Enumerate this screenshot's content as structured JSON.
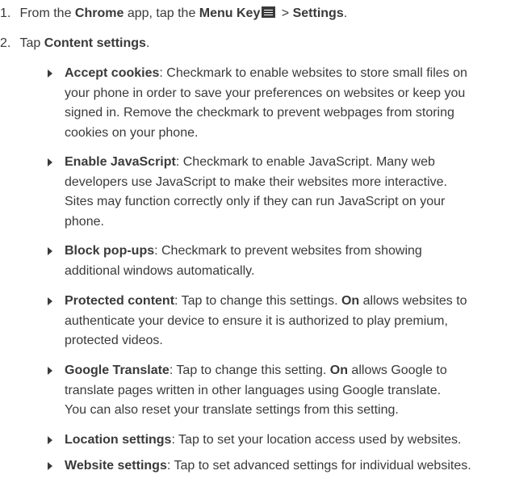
{
  "steps": [
    {
      "number": "1.",
      "pre": "From the ",
      "app": "Chrome",
      "mid1": " app, tap the ",
      "menu_key": "Menu Key",
      "icon": "menu-key-icon",
      "mid2": " > ",
      "settings": "Settings",
      "end": "."
    },
    {
      "number": "2.",
      "pre": "Tap ",
      "target": "Content settings",
      "end": "."
    }
  ],
  "bullets": [
    {
      "term": "Accept cookies",
      "desc_lines": [
        ": Checkmark to enable websites to store small files on",
        "your phone in order to save your preferences on websites or keep you",
        "signed in. Remove the checkmark to prevent webpages from storing",
        "cookies on your phone."
      ]
    },
    {
      "term": "Enable JavaScript",
      "desc_lines": [
        ": Checkmark to enable JavaScript. Many web",
        "developers use JavaScript to make their websites more interactive.",
        "Sites may function correctly only if they can run JavaScript on your",
        "phone."
      ]
    },
    {
      "term": "Block pop-ups",
      "desc_lines": [
        ": Checkmark to prevent websites from showing",
        "additional windows automatically."
      ]
    },
    {
      "term": "Protected content",
      "desc_pre": ": Tap to change this settings. ",
      "keyword": "On",
      "desc_post": " allows websites to",
      "desc_lines": [
        "authenticate your device to ensure it is authorized to play premium,",
        "protected videos."
      ]
    },
    {
      "term": "Google Translate",
      "desc_pre": ": Tap to change this setting. ",
      "keyword": "On",
      "desc_post": " allows Google to",
      "desc_lines": [
        "translate pages written in other languages using Google translate.",
        "You can also reset your translate settings from this setting."
      ]
    },
    {
      "term": "Location settings",
      "desc_lines": [
        ": Tap to set your location access used by websites."
      ]
    },
    {
      "term": "Website settings",
      "desc_lines": [
        ": Tap to set advanced settings for individual websites."
      ]
    }
  ]
}
